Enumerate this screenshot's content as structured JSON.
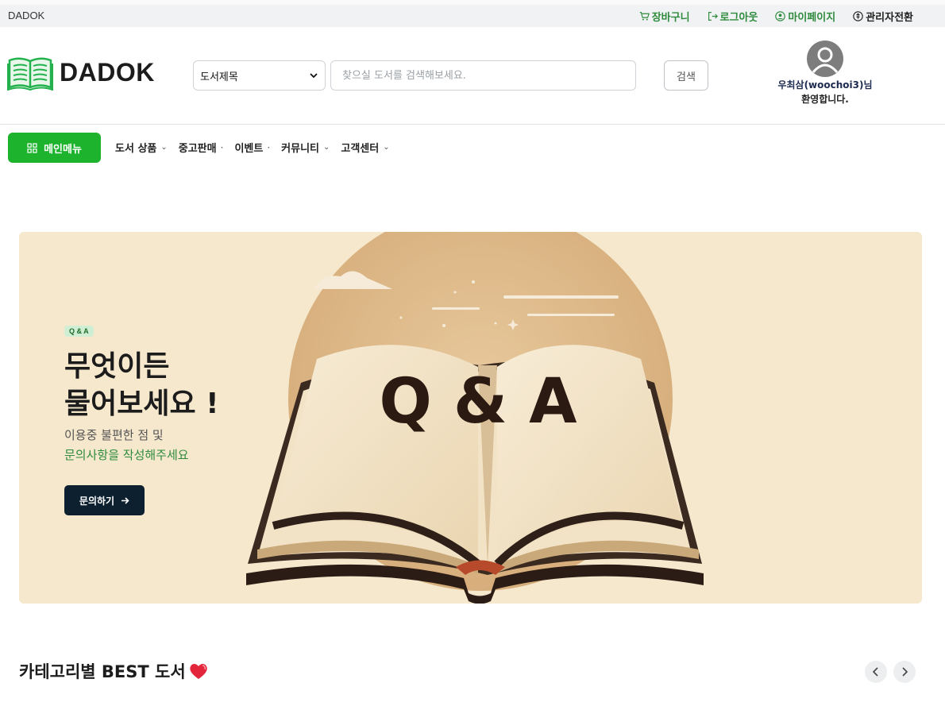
{
  "topbar": {
    "brand": "DADOK",
    "links": [
      {
        "label": "장바구니",
        "icon": "cart-icon"
      },
      {
        "label": "로그아웃",
        "icon": "logout-icon"
      },
      {
        "label": "마이페이지",
        "icon": "user-circle-icon"
      },
      {
        "label": "관리자전환",
        "icon": "admin-switch-icon"
      }
    ]
  },
  "header": {
    "logo_text": "DADOK",
    "search_select_value": "도서제목",
    "search_placeholder": "찾으실 도서를 검색해보세요.",
    "search_button": "검색",
    "user_name": "우최삼(woochoi3)님",
    "user_welcome": "환영합니다."
  },
  "nav": {
    "main_menu": "메인메뉴",
    "items": [
      {
        "label": "도서 상품",
        "marker": "⌄"
      },
      {
        "label": "중고판매",
        "marker": "·"
      },
      {
        "label": "이벤트",
        "marker": "·"
      },
      {
        "label": "커뮤니티",
        "marker": "⌄"
      },
      {
        "label": "고객센터",
        "marker": "⌄"
      }
    ]
  },
  "banner": {
    "badge": "Q & A",
    "headline_line1": "무엇이든",
    "headline_line2": "물어보세요 !",
    "sub_line1": "이용중 불편한 점 및",
    "sub_line2": "문의사항을 작성해주세요",
    "cta": "문의하기",
    "book_text": "Q & A"
  },
  "best": {
    "title": "카테고리별 BEST 도서"
  },
  "colors": {
    "brand_green": "#1db32d",
    "link_green": "#2e8b3d",
    "banner_bg": "#f5e8cd",
    "cta_bg": "#0d2030"
  }
}
